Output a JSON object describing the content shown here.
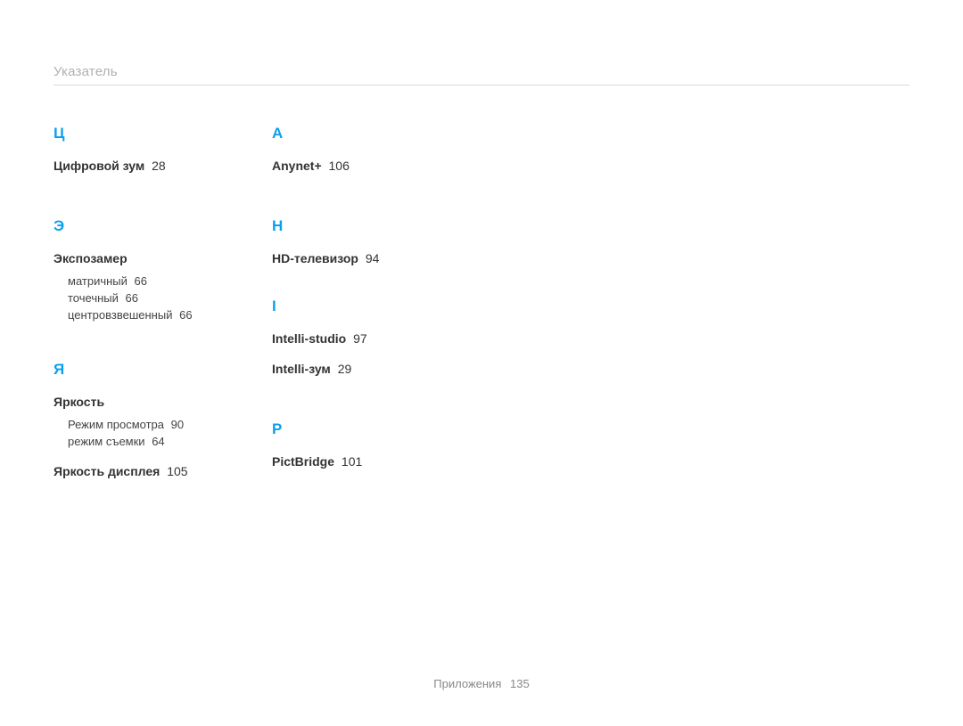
{
  "header": {
    "title": "Указатель"
  },
  "col1": {
    "sections": [
      {
        "letter": "Ц",
        "entries": [
          {
            "term": "Цифровой зум",
            "page": "28",
            "subs": []
          }
        ]
      },
      {
        "letter": "Э",
        "entries": [
          {
            "term": "Экспозамер",
            "page": "",
            "subs": [
              {
                "term": "матричный",
                "page": "66"
              },
              {
                "term": "точечный",
                "page": "66"
              },
              {
                "term": "центровзвешенный",
                "page": "66"
              }
            ]
          }
        ]
      },
      {
        "letter": "Я",
        "entries": [
          {
            "term": "Яркость",
            "page": "",
            "subs": [
              {
                "term": "Режим просмотра",
                "page": "90"
              },
              {
                "term": "режим съемки",
                "page": "64"
              }
            ]
          },
          {
            "term": "Яркость дисплея",
            "page": "105",
            "subs": []
          }
        ]
      }
    ]
  },
  "col2": {
    "sections": [
      {
        "letter": "A",
        "entries": [
          {
            "term": "Anynet+",
            "page": "106",
            "subs": []
          }
        ]
      },
      {
        "letter": "H",
        "entries": [
          {
            "term": "HD-телевизор",
            "page": "94",
            "subs": []
          }
        ]
      },
      {
        "letter": "I",
        "entries": [
          {
            "term": "Intelli-studio",
            "page": "97",
            "subs": []
          },
          {
            "term": "Intelli-зум",
            "page": "29",
            "subs": []
          }
        ]
      },
      {
        "letter": "P",
        "entries": [
          {
            "term": "PictBridge",
            "page": "101",
            "subs": []
          }
        ]
      }
    ]
  },
  "footer": {
    "section": "Приложения",
    "page": "135"
  }
}
